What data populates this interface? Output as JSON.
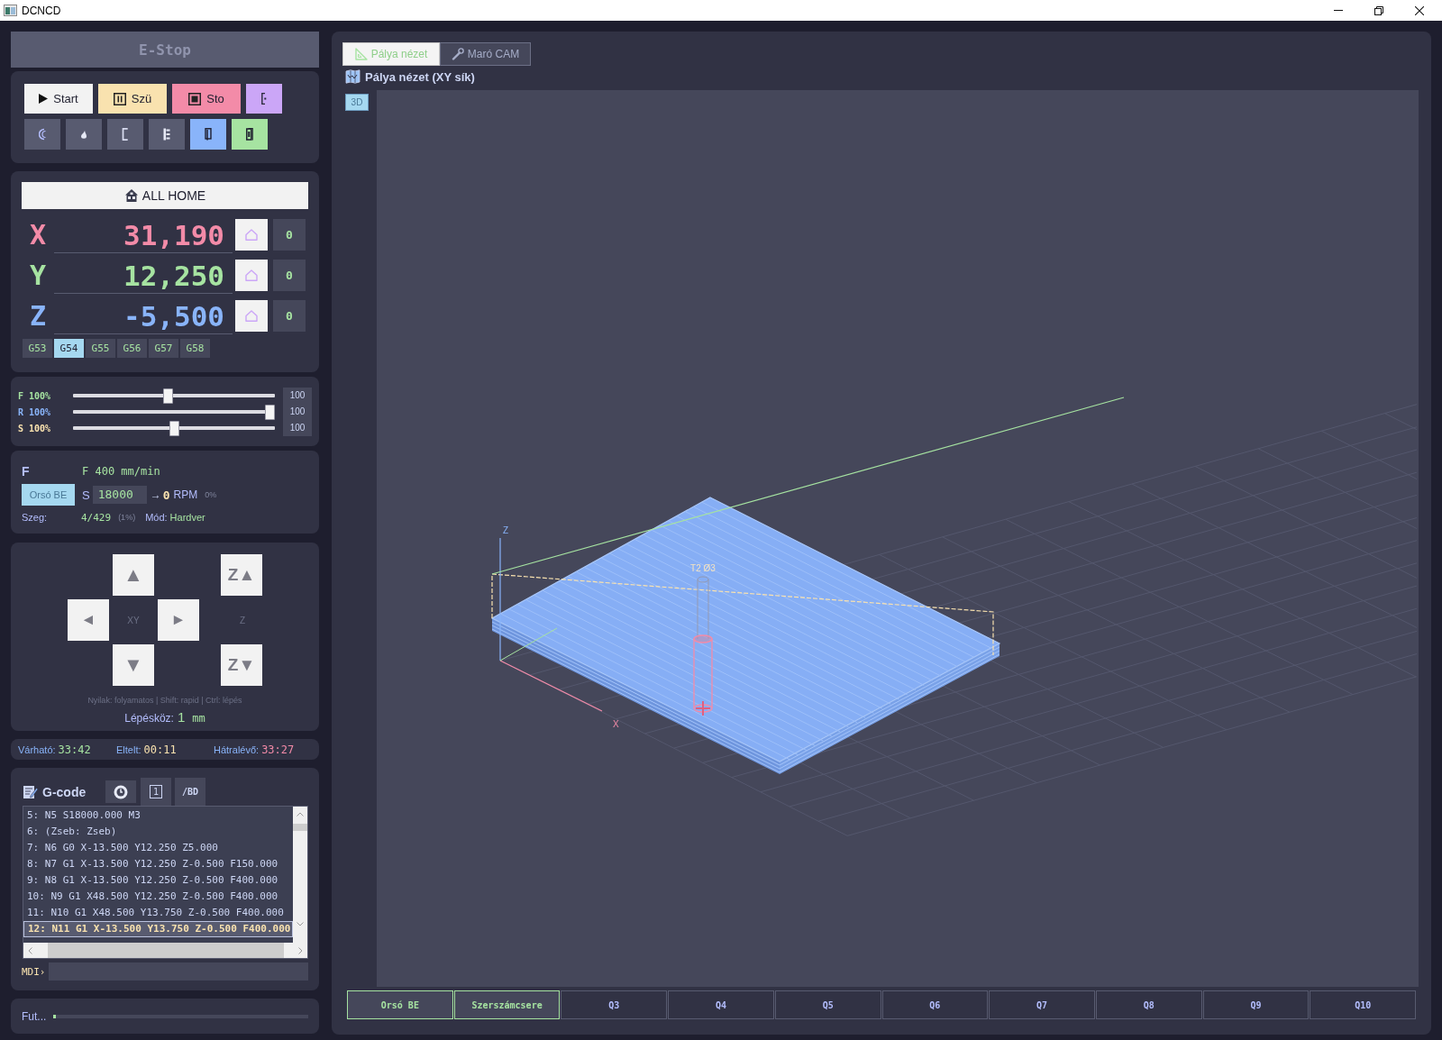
{
  "window": {
    "title": "DCNCD"
  },
  "estop": {
    "label": "E-Stop",
    "disabled": true
  },
  "program_buttons": [
    {
      "kind": "start",
      "label": "Start",
      "color": "#f2f2f2"
    },
    {
      "kind": "pause",
      "label": "Szü",
      "color": "#f9e2af"
    },
    {
      "kind": "stop",
      "label": "Sto",
      "color": "#f38ba8"
    },
    {
      "kind": "glyph",
      "color": "#cba6f7"
    }
  ],
  "tool_buttons": [
    {
      "kind": "arc",
      "color": "#585b70"
    },
    {
      "kind": "drop",
      "color": "#585b70"
    },
    {
      "kind": "bracket",
      "color": "#585b70"
    },
    {
      "kind": "bars",
      "color": "#585b70"
    },
    {
      "kind": "door",
      "color": "#89b4fa"
    },
    {
      "kind": "book",
      "color": "#a6e3a1"
    }
  ],
  "all_home": {
    "label": "ALL HOME"
  },
  "axes": [
    {
      "name": "X",
      "value": "31,190",
      "color": "#f38ba8",
      "zero_label": "0"
    },
    {
      "name": "Y",
      "value": "12,250",
      "color": "#a6e3a1",
      "zero_label": "0"
    },
    {
      "name": "Z",
      "value": "-5,500",
      "color": "#89b4fa",
      "zero_label": "0"
    }
  ],
  "work_offsets": [
    {
      "label": "G53",
      "selected": false
    },
    {
      "label": "G54",
      "selected": true
    },
    {
      "label": "G55",
      "selected": false
    },
    {
      "label": "G56",
      "selected": false
    },
    {
      "label": "G57",
      "selected": false
    },
    {
      "label": "G58",
      "selected": false
    }
  ],
  "overrides": [
    {
      "name": "F",
      "percent": "100%",
      "level": 0.47,
      "value": "100",
      "color": "#a6e3a1"
    },
    {
      "name": "R",
      "percent": "100%",
      "level": 1,
      "value": "100",
      "color": "#89b4fa"
    },
    {
      "name": "S",
      "percent": "100%",
      "level": 0.5,
      "value": "100",
      "color": "#f9e2af"
    }
  ],
  "spindle": {
    "title": "F",
    "feed": "F 400 mm/min",
    "button": "Orsó BE",
    "speed_label": "S",
    "speed_value": "18000",
    "arrow": "→",
    "rpm": "0",
    "rpm_unit": "RPM",
    "load": "0%",
    "segment_label": "Szeg:",
    "segment": "4/429",
    "segment_pct": "(1%)",
    "mode_label": "Mód:",
    "mode": "Hardver"
  },
  "jog": {
    "buttons": [
      {
        "kind": "up",
        "label": "▲"
      },
      {
        "kind": "left",
        "label": "◄"
      },
      {
        "kind": "right",
        "label": "►"
      },
      {
        "kind": "down",
        "label": "▼"
      },
      {
        "kind": "z_up",
        "label": "Z▲"
      },
      {
        "kind": "z_down",
        "label": "Z▼"
      }
    ],
    "xy_label": "XY",
    "z_label": "Z",
    "hint": "Nyilak: folyamatos | Shift: rapid | Ctrl: lépés",
    "step_label": "Lépésköz:",
    "step_value": "1",
    "step_unit": "mm"
  },
  "times": [
    {
      "label": "Várható:",
      "value": "33:42",
      "color": "#a6e3a1"
    },
    {
      "label": "Eltelt:",
      "value": "00:11",
      "color": "#f9e2af"
    },
    {
      "label": "Hátralévő:",
      "value": "33:27",
      "color": "#f38ba8"
    }
  ],
  "gcode": {
    "title": "G-code",
    "tools": [
      {
        "kind": "clock"
      },
      {
        "kind": "keycap",
        "label": "1"
      },
      {
        "kind": "text",
        "label": "/BD"
      }
    ],
    "lines": [
      {
        "text": "5: N5 S18000.000 M3",
        "selected": false
      },
      {
        "text": "6: (Zseb: Zseb)",
        "selected": false
      },
      {
        "text": "7: N6 G0 X-13.500 Y12.250 Z5.000",
        "selected": false
      },
      {
        "text": "8: N7 G1 X-13.500 Y12.250 Z-0.500 F150.000",
        "selected": false
      },
      {
        "text": "9: N8 G1 X-13.500 Y12.250 Z-0.500 F400.000",
        "selected": false
      },
      {
        "text": "10: N9 G1 X48.500 Y12.250 Z-0.500 F400.000",
        "selected": false
      },
      {
        "text": "11: N10 G1 X48.500 Y13.750 Z-0.500 F400.000",
        "selected": false
      },
      {
        "text": "12: N11 G1 X-13.500 Y13.750 Z-0.500 F400.000",
        "selected": true
      }
    ],
    "mdi_label": "MDI›"
  },
  "progress": {
    "label": "Fut...",
    "level": 0.01
  },
  "tabs": [
    {
      "label": "Pálya nézet",
      "selected": true
    },
    {
      "label": "Maró CAM",
      "selected": false
    }
  ],
  "view": {
    "title": "Pálya nézet (XY sík)",
    "mode_button": "3D",
    "axis_z": "Z",
    "axis_x": "X",
    "tool_label": "T2 Ø3"
  },
  "quick_buttons": [
    {
      "label": "Orsó BE",
      "on": true
    },
    {
      "label": "Szerszámcsere",
      "on": true
    },
    {
      "label": "Q3",
      "on": false
    },
    {
      "label": "Q4",
      "on": false
    },
    {
      "label": "Q5",
      "on": false
    },
    {
      "label": "Q6",
      "on": false
    },
    {
      "label": "Q7",
      "on": false
    },
    {
      "label": "Q8",
      "on": false
    },
    {
      "label": "Q9",
      "on": false
    },
    {
      "label": "Q10",
      "on": false
    }
  ]
}
